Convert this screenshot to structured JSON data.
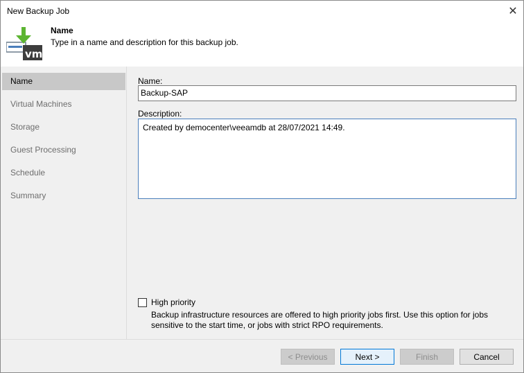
{
  "window": {
    "title": "New Backup Job",
    "close_glyph": "✕"
  },
  "header": {
    "title": "Name",
    "subtitle": "Type in a name and description for this backup job."
  },
  "sidebar": {
    "items": [
      {
        "label": "Name"
      },
      {
        "label": "Virtual Machines"
      },
      {
        "label": "Storage"
      },
      {
        "label": "Guest Processing"
      },
      {
        "label": "Schedule"
      },
      {
        "label": "Summary"
      }
    ]
  },
  "form": {
    "name_label": "Name:",
    "name_value": "Backup-SAP",
    "description_label": "Description:",
    "description_value": "Created by democenter\\veeamdb at 28/07/2021 14:49.",
    "high_priority_label": "High priority",
    "high_priority_checked": false,
    "high_priority_desc": "Backup infrastructure resources are offered to high priority jobs first. Use this option for jobs sensitive to the start time, or jobs with strict RPO requirements."
  },
  "footer": {
    "previous": "< Previous",
    "next": "Next >",
    "finish": "Finish",
    "cancel": "Cancel"
  },
  "colors": {
    "accent": "#0078d7",
    "icon_green": "#5cb531",
    "icon_dark": "#3d3d3d",
    "selected": "#c8c8c8"
  },
  "icons": {
    "header": "vm-backup-icon",
    "close": "close-icon"
  }
}
